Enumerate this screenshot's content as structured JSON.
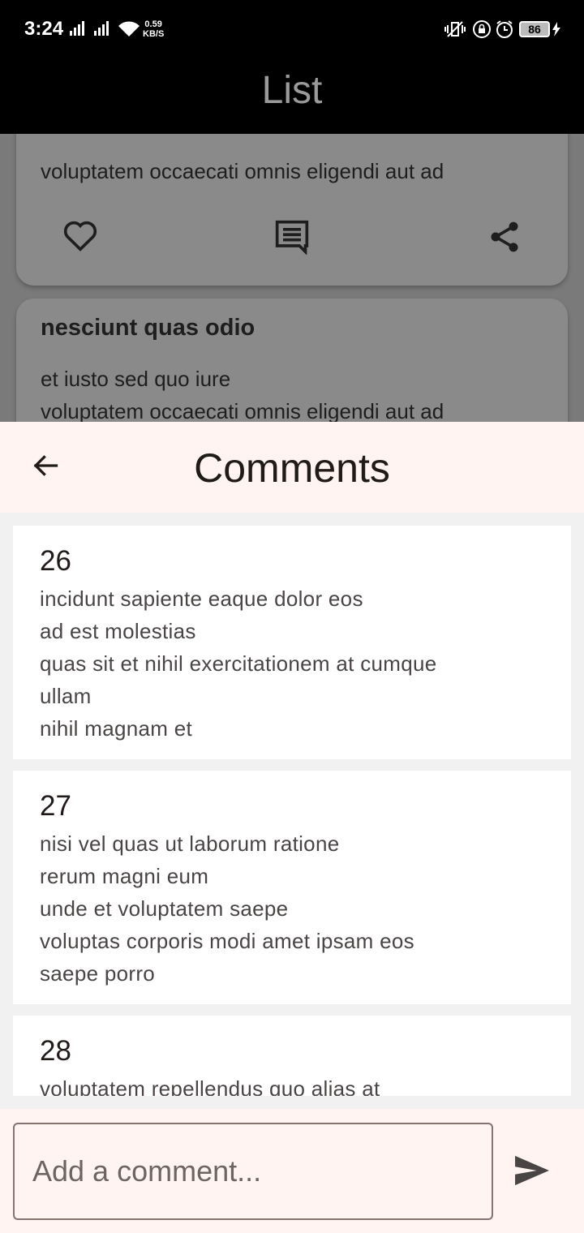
{
  "status_bar": {
    "time": "3:24",
    "net_speed_value": "0.59",
    "net_speed_unit": "KB/S",
    "battery": "86",
    "icons": [
      "signal-icon",
      "signal-icon",
      "wifi-icon",
      "vibrate-icon",
      "rotation-lock-icon",
      "alarm-icon",
      "battery-icon",
      "charging-icon"
    ]
  },
  "app_bar": {
    "title": "List"
  },
  "background_list": {
    "card1": {
      "body_line": "voluptatem occaecati omnis eligendi aut ad"
    },
    "card2": {
      "title": "nesciunt quas odio",
      "body_line1": "et iusto sed quo iure",
      "body_line2": "voluptatem occaecati omnis eligendi aut ad"
    },
    "actions": [
      "heart-icon",
      "comment-icon",
      "share-icon"
    ]
  },
  "comments_sheet": {
    "title": "Comments",
    "comments": [
      {
        "id": "26",
        "body": "incidunt sapiente eaque dolor eos\nad est molestias\nquas sit et nihil exercitationem at cumque\nullam\nnihil magnam et"
      },
      {
        "id": "27",
        "body": "nisi vel quas ut laborum ratione\nrerum magni eum\nunde et voluptatem saepe\nvoluptas corporis modi amet ipsam eos\nsaepe porro"
      },
      {
        "id": "28",
        "body": "voluptatem repellendus quo alias at"
      }
    ],
    "input": {
      "placeholder": "Add a comment...",
      "value": ""
    }
  },
  "colors": {
    "sheet_surface": "#fff4f2",
    "scrim": "#7a7a7a",
    "list_background": "#f1f1f1",
    "on_surface": "#201a19"
  }
}
